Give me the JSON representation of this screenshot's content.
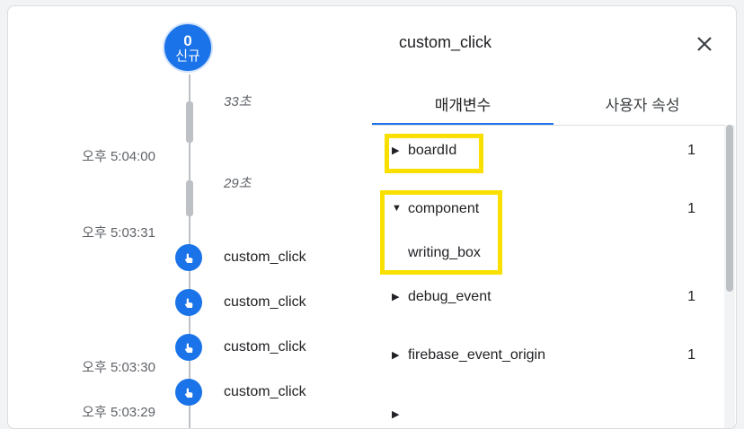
{
  "timeline": {
    "start_badge": {
      "count": "0",
      "label": "신규"
    },
    "gaps": [
      "33초",
      "29초"
    ],
    "times": [
      "오후 5:04:00",
      "오후 5:03:31",
      "오후 5:03:30",
      "오후 5:03:29"
    ],
    "events": [
      "custom_click",
      "custom_click",
      "custom_click",
      "custom_click"
    ]
  },
  "panel": {
    "title": "custom_click",
    "close_icon": "close-icon",
    "tabs": [
      {
        "label": "매개변수",
        "active": true
      },
      {
        "label": "사용자 속성",
        "active": false
      }
    ],
    "params": [
      {
        "key": "boardId",
        "count": "1",
        "expanded": false
      },
      {
        "key": "component",
        "count": "1",
        "expanded": true,
        "value": "writing_box"
      },
      {
        "key": "debug_event",
        "count": "1",
        "expanded": false
      },
      {
        "key": "firebase_event_origin",
        "count": "1",
        "expanded": false
      }
    ]
  },
  "colors": {
    "accent": "#1a73e8",
    "highlight": "#f9e000",
    "timeline_line": "#bdc1c6",
    "muted_text": "#5f6368"
  }
}
